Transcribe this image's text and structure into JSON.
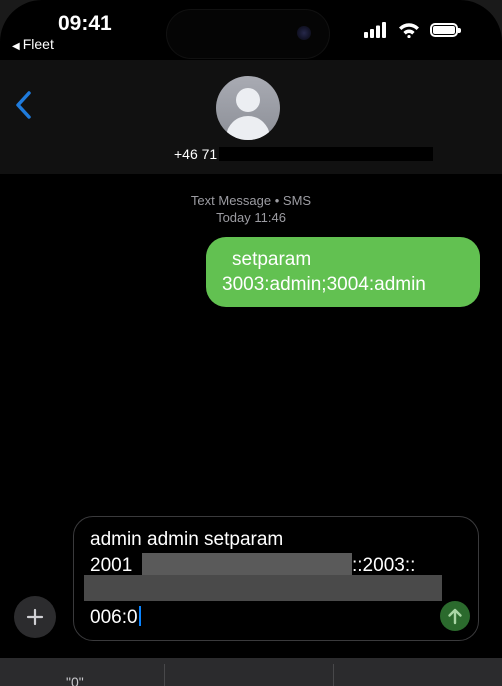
{
  "status_bar": {
    "time": "09:41",
    "back_app": "Fleet",
    "battery_level": 1.0,
    "icons": [
      "cellular-signal-icon",
      "wifi-icon",
      "battery-icon"
    ]
  },
  "header": {
    "back_icon": "chevron-left-icon",
    "avatar_icon": "person-avatar-icon",
    "contact_number": "+46 71"
  },
  "conversation": {
    "meta_type": "Text Message • SMS",
    "meta_time": "Today 11:46",
    "outgoing": {
      "line1": "setparam",
      "line2": "3003:admin;3004:admin"
    }
  },
  "compose": {
    "line1": "admin admin setparam",
    "line2_start": "2001",
    "line2_end": "::2003::",
    "line4": "006:0",
    "plus_icon": "plus-icon",
    "send_icon": "arrow-up-icon"
  },
  "keyboard": {
    "suggestion_1": "\"0\""
  },
  "colors": {
    "bubble_green": "#62c151",
    "send_green": "#2b6a2d",
    "accent_blue": "#1f7bdc",
    "background": "#000000"
  }
}
